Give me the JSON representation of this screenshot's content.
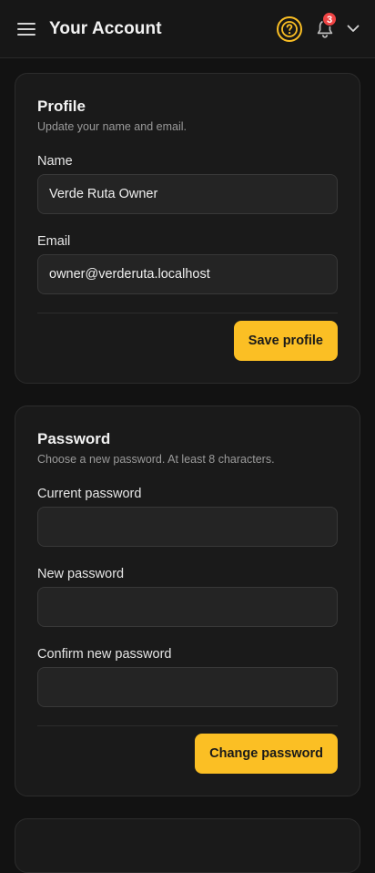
{
  "header": {
    "title": "Your Account",
    "notification_count": "3"
  },
  "profile": {
    "title": "Profile",
    "subtitle": "Update your name and email.",
    "name_label": "Name",
    "name_value": "Verde Ruta Owner",
    "email_label": "Email",
    "email_value": "owner@verderuta.localhost",
    "save_label": "Save profile"
  },
  "password": {
    "title": "Password",
    "subtitle": "Choose a new password. At least 8 characters.",
    "current_label": "Current password",
    "current_value": "",
    "new_label": "New password",
    "new_value": "",
    "confirm_label": "Confirm new password",
    "confirm_value": "",
    "change_label": "Change password"
  },
  "colors": {
    "accent": "#fbbf24",
    "badge": "#ef4444",
    "background": "#121212",
    "card": "#1a1a1a"
  },
  "icons": {
    "menu": "hamburger-menu-icon",
    "help": "question-circle-icon",
    "notifications": "bell-icon",
    "account_dropdown": "chevron-down-icon"
  }
}
